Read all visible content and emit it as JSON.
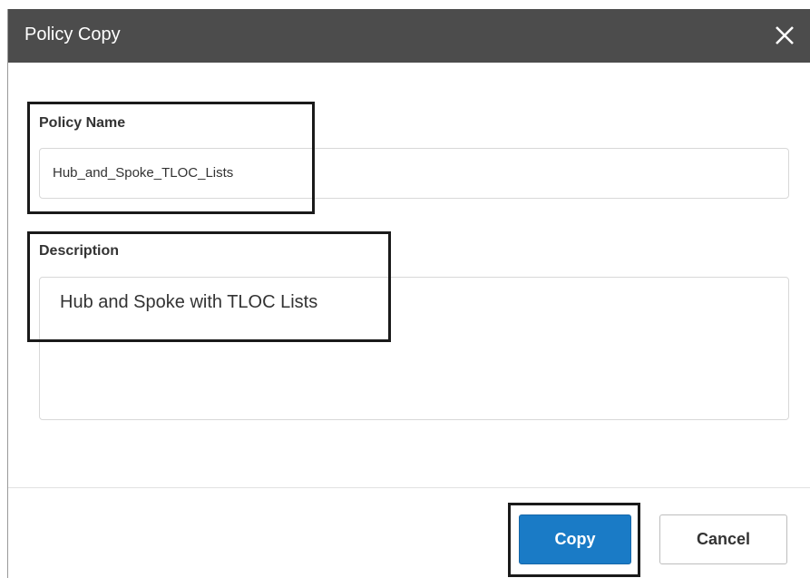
{
  "dialog": {
    "title": "Policy Copy",
    "close_icon": "close-icon"
  },
  "form": {
    "policy_name_label": "Policy Name",
    "policy_name_value": "Hub_and_Spoke_TLOC_Lists",
    "description_label": "Description",
    "description_value": "Hub and Spoke with TLOC Lists"
  },
  "footer": {
    "copy_label": "Copy",
    "cancel_label": "Cancel"
  },
  "colors": {
    "titlebar_bg": "#4c4c4c",
    "primary_button": "#1a7bc6",
    "highlight_border": "#1a1a1a"
  }
}
